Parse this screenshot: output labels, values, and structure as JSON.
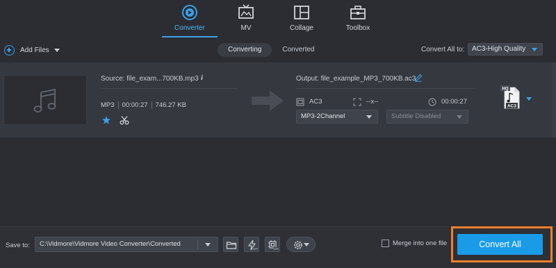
{
  "nav": {
    "tabs": [
      {
        "label": "Converter",
        "icon": "converter-icon",
        "active": true
      },
      {
        "label": "MV",
        "icon": "tv-icon",
        "active": false
      },
      {
        "label": "Collage",
        "icon": "collage-icon",
        "active": false
      },
      {
        "label": "Toolbox",
        "icon": "toolbox-icon",
        "active": false
      }
    ]
  },
  "toolbar": {
    "add_files_label": "Add Files",
    "subtabs": [
      {
        "label": "Converting",
        "active": true
      },
      {
        "label": "Converted",
        "active": false
      }
    ],
    "convert_all_to_label": "Convert All to:",
    "convert_all_to_value": "AC3-High Quality"
  },
  "file": {
    "source_label": "Source: file_exam...700KB.mp3",
    "format": "MP3",
    "duration": "00:00:27",
    "size": "746.27 KB",
    "output_label": "Output: file_example_MP3_700KB.ac3",
    "output_format": "AC3",
    "output_resolution": "--x--",
    "output_duration": "00:00:27",
    "channel_value": "MP3-2Channel",
    "subtitle_value": "Subtitle Disabled",
    "format_badge": "AC3",
    "hq_badge": "HQ"
  },
  "bottom": {
    "save_to_label": "Save to:",
    "save_path": "C:\\Vidmore\\Vidmore Video Converter\\Converted",
    "merge_label": "Merge into one file",
    "convert_all_label": "Convert All"
  },
  "colors": {
    "accent": "#1a9be8",
    "highlight": "#f0802c",
    "background": "#2b2d33",
    "row_background": "#35383f"
  }
}
